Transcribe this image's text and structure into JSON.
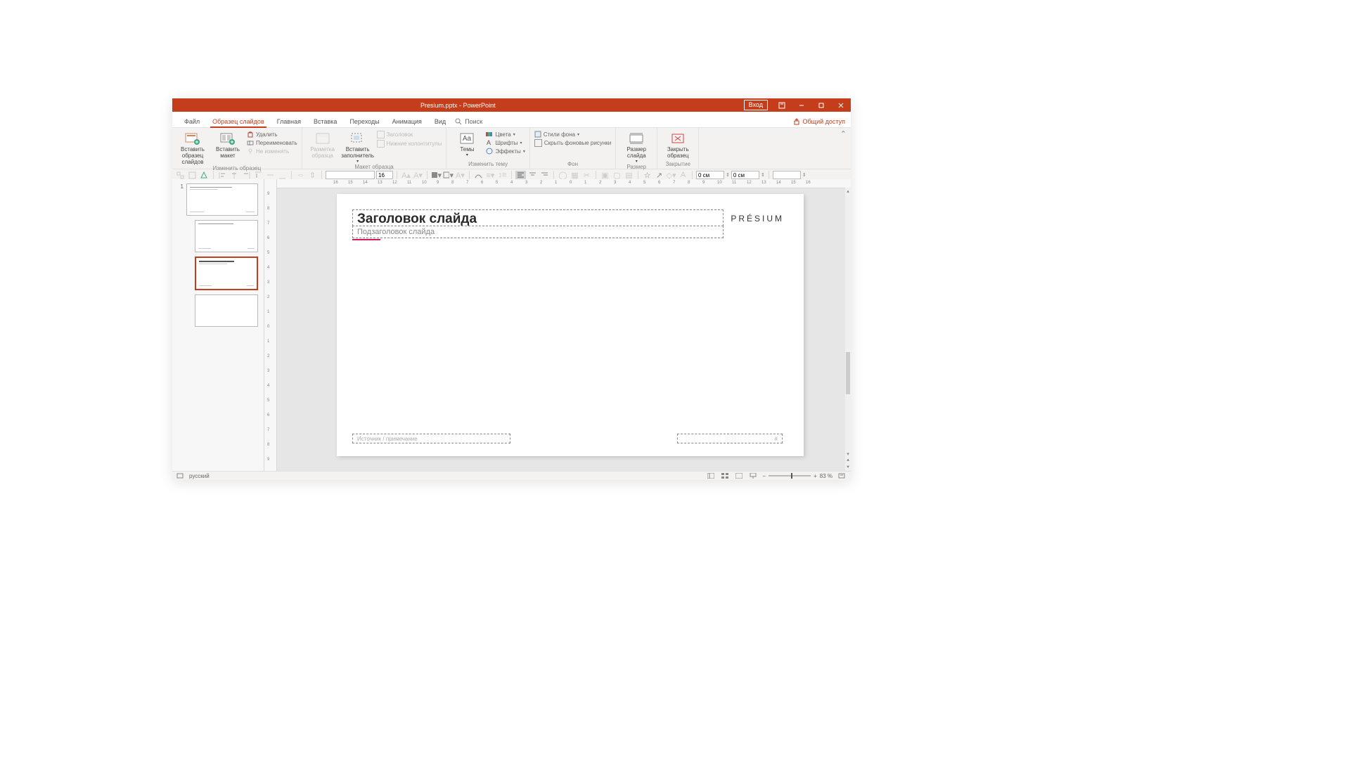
{
  "titlebar": {
    "title": "Presium.pptx - PowerPoint",
    "login": "Вход"
  },
  "menu": {
    "file": "Файл",
    "slidemaster": "Образец слайдов",
    "home": "Главная",
    "insert": "Вставка",
    "transitions": "Переходы",
    "animation": "Анимация",
    "view": "Вид",
    "search": "Поиск",
    "share": "Общий доступ"
  },
  "ribbon": {
    "edit_master": {
      "insert_master": "Вставить образец слайдов",
      "insert_layout": "Вставить макет",
      "delete": "Удалить",
      "rename": "Переименовать",
      "preserve": "Не изменять",
      "label": "Изменить образец"
    },
    "master_layout": {
      "master_layout": "Разметка образца",
      "insert_placeholder": "Вставить заполнитель",
      "title_chk": "Заголовок",
      "footers_chk": "Нижние колонтитулы",
      "label": "Макет образца"
    },
    "edit_theme": {
      "themes": "Темы",
      "colors": "Цвета",
      "fonts": "Шрифты",
      "effects": "Эффекты",
      "label": "Изменить тему"
    },
    "background": {
      "bg_styles": "Стили фона",
      "hide_bg": "Скрыть фоновые рисунки",
      "label": "Фон"
    },
    "size": {
      "slide_size": "Размер слайда",
      "label": "Размер"
    },
    "close": {
      "close_master": "Закрыть образец",
      "label": "Закрытие"
    }
  },
  "qa": {
    "font_size": "16",
    "w_label": "0 см",
    "h_label": "0 см"
  },
  "thumbs": {
    "n1": "1"
  },
  "slide": {
    "title": "Заголовок слайда",
    "subtitle": "Подзаголовок слайда",
    "source": "Источник / примечание",
    "page": "#",
    "logo": "PRÉSIUM"
  },
  "status": {
    "lang": "русский",
    "zoom": "83 %"
  },
  "ruler_ticks": [
    "16",
    "15",
    "14",
    "13",
    "12",
    "11",
    "10",
    "9",
    "8",
    "7",
    "6",
    "5",
    "4",
    "3",
    "2",
    "1",
    "0",
    "1",
    "2",
    "3",
    "4",
    "5",
    "6",
    "7",
    "8",
    "9",
    "10",
    "11",
    "12",
    "13",
    "14",
    "15",
    "16"
  ],
  "vruler_ticks": [
    "9",
    "8",
    "7",
    "6",
    "5",
    "4",
    "3",
    "2",
    "1",
    "0",
    "1",
    "2",
    "3",
    "4",
    "5",
    "6",
    "7",
    "8",
    "9"
  ]
}
